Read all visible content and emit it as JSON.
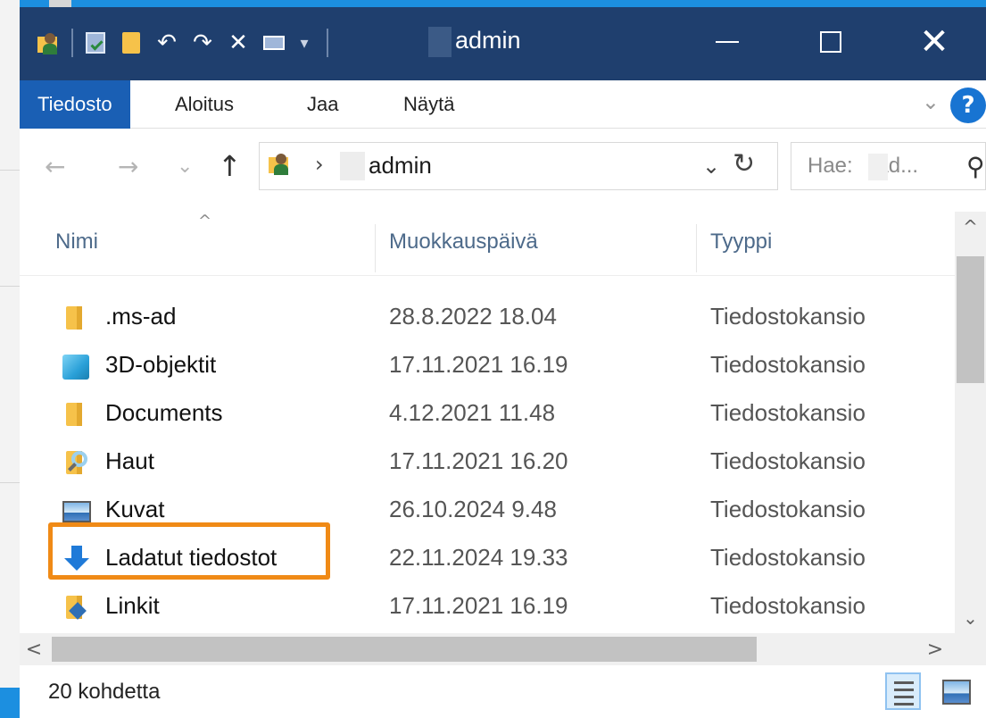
{
  "window": {
    "title": "admin",
    "colors": {
      "titlebar": "#1f3f6e",
      "accent": "#1a5fb4",
      "highlight": "#f08a16"
    }
  },
  "quick_access": [
    {
      "name": "folder-user-icon"
    },
    {
      "name": "properties-icon"
    },
    {
      "name": "new-folder-icon"
    },
    {
      "name": "undo-icon",
      "glyph": "↶"
    },
    {
      "name": "redo-icon",
      "glyph": "↷"
    },
    {
      "name": "delete-icon",
      "glyph": "✕"
    },
    {
      "name": "rename-icon"
    },
    {
      "name": "customize-dropdown-icon",
      "glyph": "▾"
    }
  ],
  "ribbon": {
    "tabs": [
      "Tiedosto",
      "Aloitus",
      "Jaa",
      "Näytä"
    ],
    "active": 0
  },
  "navigation": {
    "back": "←",
    "forward": "→",
    "recent": "⌄",
    "up": "↑",
    "breadcrumb_sep": "›",
    "address": "admin",
    "address_dropdown": "⌄",
    "refresh": "↻",
    "search_placeholder": "Hae:    ad...",
    "search_icon": "⚲"
  },
  "columns": {
    "name": "Nimi",
    "modified": "Muokkauspäivä",
    "type": "Tyyppi"
  },
  "files": [
    {
      "name": ".ms-ad",
      "modified": "28.8.2022 18.04",
      "type": "Tiedostokansio",
      "icon": "folder-icon"
    },
    {
      "name": "3D-objektit",
      "modified": "17.11.2021 16.19",
      "type": "Tiedostokansio",
      "icon": "3d-objects-icon"
    },
    {
      "name": "Documents",
      "modified": "4.12.2021 11.48",
      "type": "Tiedostokansio",
      "icon": "folder-icon"
    },
    {
      "name": "Haut",
      "modified": "17.11.2021 16.20",
      "type": "Tiedostokansio",
      "icon": "searches-icon"
    },
    {
      "name": "Kuvat",
      "modified": "26.10.2024 9.48",
      "type": "Tiedostokansio",
      "icon": "pictures-icon"
    },
    {
      "name": "Ladatut tiedostot",
      "modified": "22.11.2024 19.33",
      "type": "Tiedostokansio",
      "icon": "downloads-icon",
      "highlighted": true
    },
    {
      "name": "Linkit",
      "modified": "17.11.2021 16.19",
      "type": "Tiedostokansio",
      "icon": "links-icon"
    }
  ],
  "scrollbars": {
    "up": "^",
    "down": "⌄",
    "left": "<",
    "right": ">"
  },
  "status": {
    "item_count": "20 kohdetta"
  }
}
